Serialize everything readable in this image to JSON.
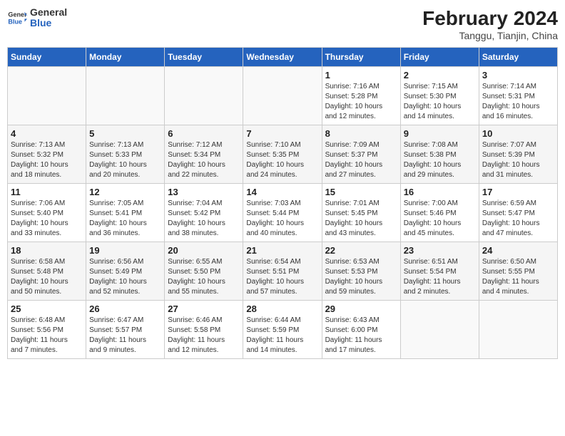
{
  "header": {
    "logo_general": "General",
    "logo_blue": "Blue",
    "month_year": "February 2024",
    "location": "Tanggu, Tianjin, China"
  },
  "weekdays": [
    "Sunday",
    "Monday",
    "Tuesday",
    "Wednesday",
    "Thursday",
    "Friday",
    "Saturday"
  ],
  "weeks": [
    [
      {
        "day": "",
        "info": ""
      },
      {
        "day": "",
        "info": ""
      },
      {
        "day": "",
        "info": ""
      },
      {
        "day": "",
        "info": ""
      },
      {
        "day": "1",
        "info": "Sunrise: 7:16 AM\nSunset: 5:28 PM\nDaylight: 10 hours\nand 12 minutes."
      },
      {
        "day": "2",
        "info": "Sunrise: 7:15 AM\nSunset: 5:30 PM\nDaylight: 10 hours\nand 14 minutes."
      },
      {
        "day": "3",
        "info": "Sunrise: 7:14 AM\nSunset: 5:31 PM\nDaylight: 10 hours\nand 16 minutes."
      }
    ],
    [
      {
        "day": "4",
        "info": "Sunrise: 7:13 AM\nSunset: 5:32 PM\nDaylight: 10 hours\nand 18 minutes."
      },
      {
        "day": "5",
        "info": "Sunrise: 7:13 AM\nSunset: 5:33 PM\nDaylight: 10 hours\nand 20 minutes."
      },
      {
        "day": "6",
        "info": "Sunrise: 7:12 AM\nSunset: 5:34 PM\nDaylight: 10 hours\nand 22 minutes."
      },
      {
        "day": "7",
        "info": "Sunrise: 7:10 AM\nSunset: 5:35 PM\nDaylight: 10 hours\nand 24 minutes."
      },
      {
        "day": "8",
        "info": "Sunrise: 7:09 AM\nSunset: 5:37 PM\nDaylight: 10 hours\nand 27 minutes."
      },
      {
        "day": "9",
        "info": "Sunrise: 7:08 AM\nSunset: 5:38 PM\nDaylight: 10 hours\nand 29 minutes."
      },
      {
        "day": "10",
        "info": "Sunrise: 7:07 AM\nSunset: 5:39 PM\nDaylight: 10 hours\nand 31 minutes."
      }
    ],
    [
      {
        "day": "11",
        "info": "Sunrise: 7:06 AM\nSunset: 5:40 PM\nDaylight: 10 hours\nand 33 minutes."
      },
      {
        "day": "12",
        "info": "Sunrise: 7:05 AM\nSunset: 5:41 PM\nDaylight: 10 hours\nand 36 minutes."
      },
      {
        "day": "13",
        "info": "Sunrise: 7:04 AM\nSunset: 5:42 PM\nDaylight: 10 hours\nand 38 minutes."
      },
      {
        "day": "14",
        "info": "Sunrise: 7:03 AM\nSunset: 5:44 PM\nDaylight: 10 hours\nand 40 minutes."
      },
      {
        "day": "15",
        "info": "Sunrise: 7:01 AM\nSunset: 5:45 PM\nDaylight: 10 hours\nand 43 minutes."
      },
      {
        "day": "16",
        "info": "Sunrise: 7:00 AM\nSunset: 5:46 PM\nDaylight: 10 hours\nand 45 minutes."
      },
      {
        "day": "17",
        "info": "Sunrise: 6:59 AM\nSunset: 5:47 PM\nDaylight: 10 hours\nand 47 minutes."
      }
    ],
    [
      {
        "day": "18",
        "info": "Sunrise: 6:58 AM\nSunset: 5:48 PM\nDaylight: 10 hours\nand 50 minutes."
      },
      {
        "day": "19",
        "info": "Sunrise: 6:56 AM\nSunset: 5:49 PM\nDaylight: 10 hours\nand 52 minutes."
      },
      {
        "day": "20",
        "info": "Sunrise: 6:55 AM\nSunset: 5:50 PM\nDaylight: 10 hours\nand 55 minutes."
      },
      {
        "day": "21",
        "info": "Sunrise: 6:54 AM\nSunset: 5:51 PM\nDaylight: 10 hours\nand 57 minutes."
      },
      {
        "day": "22",
        "info": "Sunrise: 6:53 AM\nSunset: 5:53 PM\nDaylight: 10 hours\nand 59 minutes."
      },
      {
        "day": "23",
        "info": "Sunrise: 6:51 AM\nSunset: 5:54 PM\nDaylight: 11 hours\nand 2 minutes."
      },
      {
        "day": "24",
        "info": "Sunrise: 6:50 AM\nSunset: 5:55 PM\nDaylight: 11 hours\nand 4 minutes."
      }
    ],
    [
      {
        "day": "25",
        "info": "Sunrise: 6:48 AM\nSunset: 5:56 PM\nDaylight: 11 hours\nand 7 minutes."
      },
      {
        "day": "26",
        "info": "Sunrise: 6:47 AM\nSunset: 5:57 PM\nDaylight: 11 hours\nand 9 minutes."
      },
      {
        "day": "27",
        "info": "Sunrise: 6:46 AM\nSunset: 5:58 PM\nDaylight: 11 hours\nand 12 minutes."
      },
      {
        "day": "28",
        "info": "Sunrise: 6:44 AM\nSunset: 5:59 PM\nDaylight: 11 hours\nand 14 minutes."
      },
      {
        "day": "29",
        "info": "Sunrise: 6:43 AM\nSunset: 6:00 PM\nDaylight: 11 hours\nand 17 minutes."
      },
      {
        "day": "",
        "info": ""
      },
      {
        "day": "",
        "info": ""
      }
    ]
  ]
}
